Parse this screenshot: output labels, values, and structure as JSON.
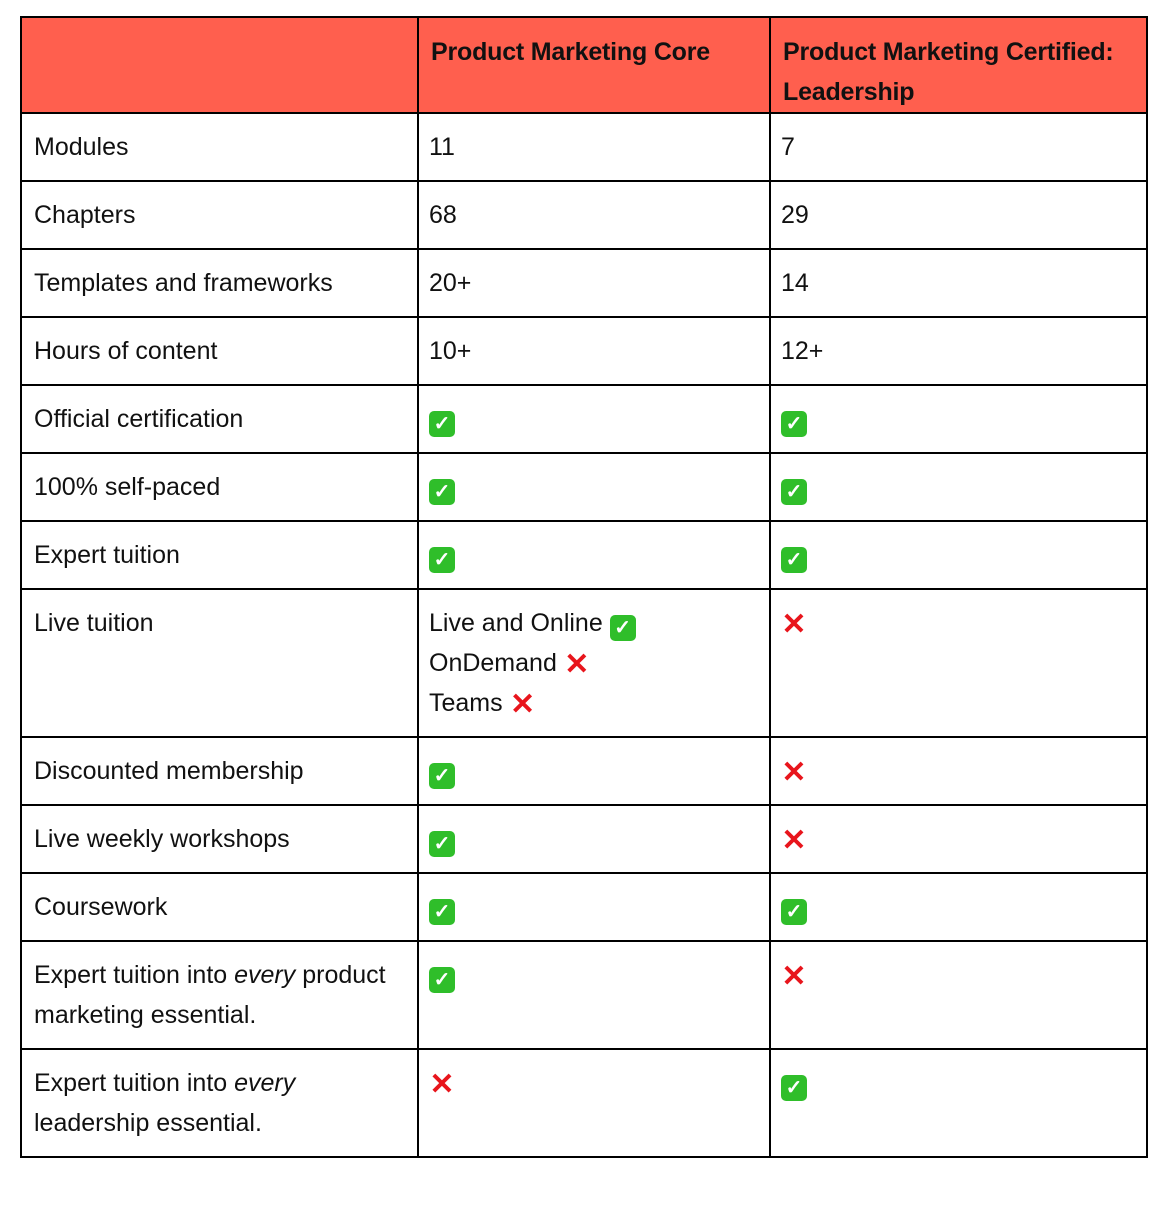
{
  "table": {
    "headers": [
      "",
      "Product Marketing Core",
      "Product Marketing Certified: Leadership"
    ],
    "icons": {
      "yes": "check-mark-button-icon",
      "no": "cross-mark-icon",
      "yes_glyph": "✓",
      "no_glyph": "✕"
    },
    "rows": [
      {
        "label": "Modules",
        "core": "11",
        "leadership": "7"
      },
      {
        "label": "Chapters",
        "core": "68",
        "leadership": "29"
      },
      {
        "label": "Templates and frameworks",
        "core": "20+",
        "leadership": "14"
      },
      {
        "label": "Hours of content",
        "core": "10+",
        "leadership": "12+"
      },
      {
        "label": "Official certification",
        "core": "yes",
        "leadership": "yes"
      },
      {
        "label": "100% self-paced",
        "core": "yes",
        "leadership": "yes"
      },
      {
        "label": "Expert tuition",
        "core": "yes",
        "leadership": "yes"
      },
      {
        "label": "Live tuition",
        "core_items": [
          {
            "text": "Live and Online",
            "status": "yes"
          },
          {
            "text": "OnDemand",
            "status": "no"
          },
          {
            "text": "Teams",
            "status": "no"
          }
        ],
        "leadership": "no"
      },
      {
        "label": "Discounted membership",
        "core": "yes",
        "leadership": "no"
      },
      {
        "label": "Live weekly workshops",
        "core": "yes",
        "leadership": "no"
      },
      {
        "label": "Coursework",
        "core": "yes",
        "leadership": "yes"
      },
      {
        "label_parts": [
          "Expert tuition into ",
          "every",
          " product marketing essential."
        ],
        "core": "yes",
        "leadership": "no"
      },
      {
        "label_parts": [
          "Expert tuition into ",
          "every",
          " leadership essential."
        ],
        "core": "no",
        "leadership": "yes"
      }
    ]
  }
}
